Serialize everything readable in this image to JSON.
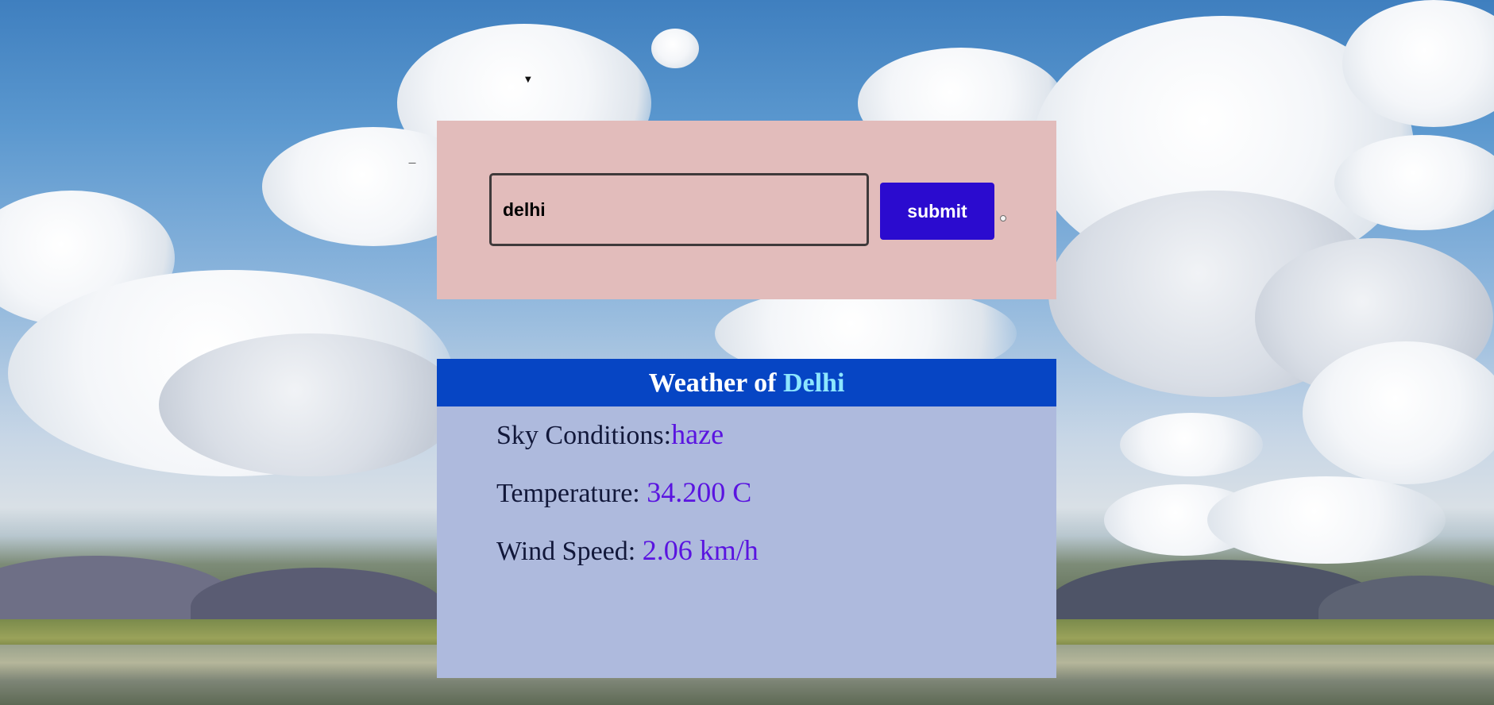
{
  "search": {
    "city_value": "delhi",
    "submit_label": "submit"
  },
  "weather": {
    "title_prefix": "Weather of",
    "city": "Delhi",
    "sky_label": "Sky Conditions:",
    "sky_value": "haze",
    "temp_label": "Temperature: ",
    "temp_value": "34.200 C",
    "wind_label": "Wind Speed: ",
    "wind_value": "2.06 km/h"
  },
  "colors": {
    "search_panel_bg": "#e2bcbb",
    "submit_bg": "#2b0bcf",
    "header_bg": "#0645c4",
    "city_accent": "#8de6ff",
    "card_bg": "#aebadd",
    "value_color": "#5a14e0"
  }
}
